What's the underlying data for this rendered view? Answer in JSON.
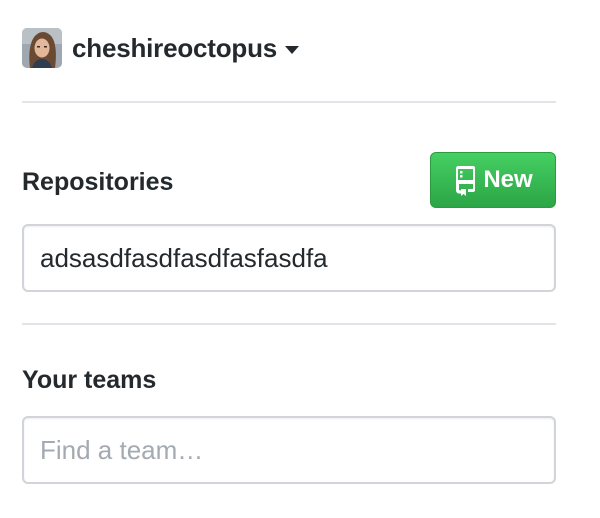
{
  "account": {
    "username": "cheshireoctopus"
  },
  "repositories": {
    "heading": "Repositories",
    "new_button_label": "New",
    "filter_value": "adsasdfasdfasdfasfasdfa"
  },
  "teams": {
    "heading": "Your teams",
    "filter_placeholder": "Find a team…"
  },
  "colors": {
    "accent_green": "#2ea44f",
    "text": "#24292e",
    "border": "#d1d5da"
  },
  "icons": {
    "new_button_icon": "repo-book-icon",
    "account_caret": "caret-down-icon"
  }
}
